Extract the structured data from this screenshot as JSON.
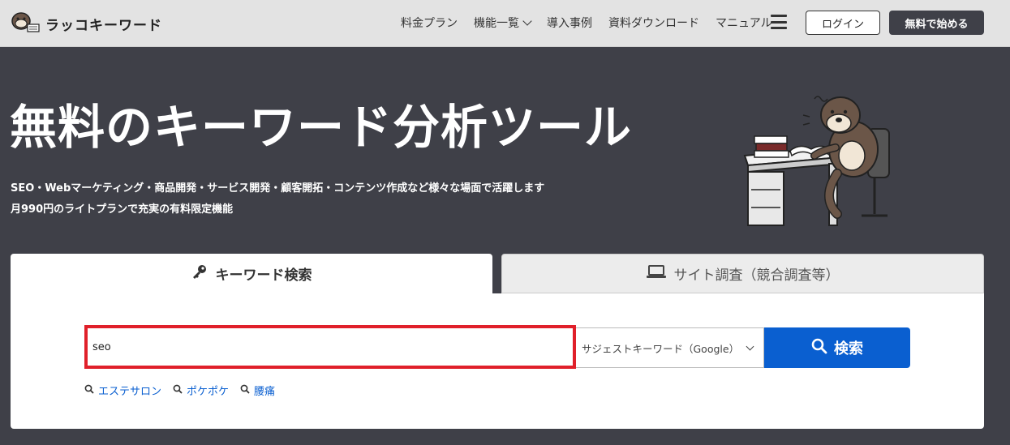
{
  "header": {
    "logo_text": "ラッコキーワード",
    "nav": [
      {
        "label": "料金プラン"
      },
      {
        "label": "機能一覧"
      },
      {
        "label": "導入事例"
      },
      {
        "label": "資料ダウンロード"
      },
      {
        "label": "マニュアル"
      }
    ],
    "login_label": "ログイン",
    "start_label": "無料で始める"
  },
  "hero": {
    "title": "無料のキーワード分析ツール",
    "subtitle_line1": "SEO・Webマーケティング・商品開発・サービス開発・顧客開拓・コンテンツ作成など様々な場面で活躍します",
    "subtitle_line2": "月990円のライトプランで充実の有料限定機能"
  },
  "tabs": {
    "keyword_label": "キーワード検索",
    "site_label": "サイト調査（競合調査等）"
  },
  "search": {
    "input_value": "seo",
    "mode_value": "サジェストキーワード（Google）",
    "button_label": "検索",
    "suggestions": [
      "エステサロン",
      "ポケポケ",
      "腰痛"
    ]
  },
  "colors": {
    "header_bg": "#e3e3e3",
    "hero_bg": "#3f4048",
    "primary": "#0a5fd0",
    "highlight": "#e0202a"
  },
  "icons": [
    "otter-logo-icon",
    "chevron-down-icon",
    "menu-icon",
    "key-icon",
    "laptop-icon",
    "search-icon"
  ]
}
